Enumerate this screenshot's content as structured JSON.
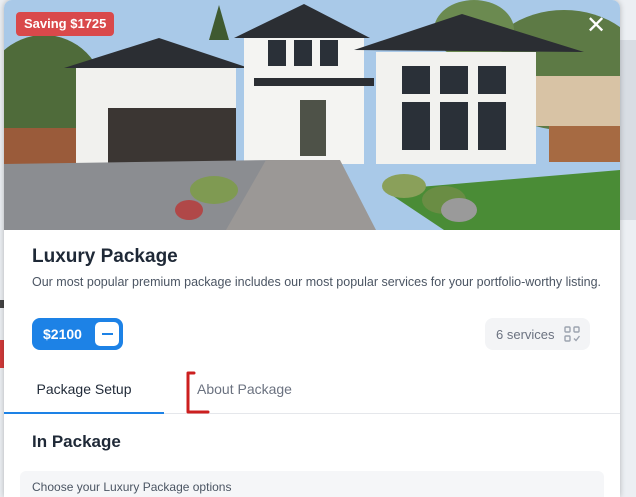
{
  "badge": {
    "saving": "Saving $1725"
  },
  "modal": {
    "close_glyph": "✕"
  },
  "package": {
    "title": "Luxury Package",
    "description": "Our most popular premium package includes our most popular services for your portfolio-worthy listing.",
    "price": "$2100",
    "services": "6 services"
  },
  "tabs": [
    {
      "label": "Package Setup",
      "active": true
    },
    {
      "label": "About Package",
      "active": false
    }
  ],
  "in_package": {
    "title": "In Package",
    "options_hint": "Choose your Luxury Package options"
  },
  "colors": {
    "accent": "#1d82e6",
    "badge": "#d9494b",
    "annotation": "#cc1f1f"
  }
}
